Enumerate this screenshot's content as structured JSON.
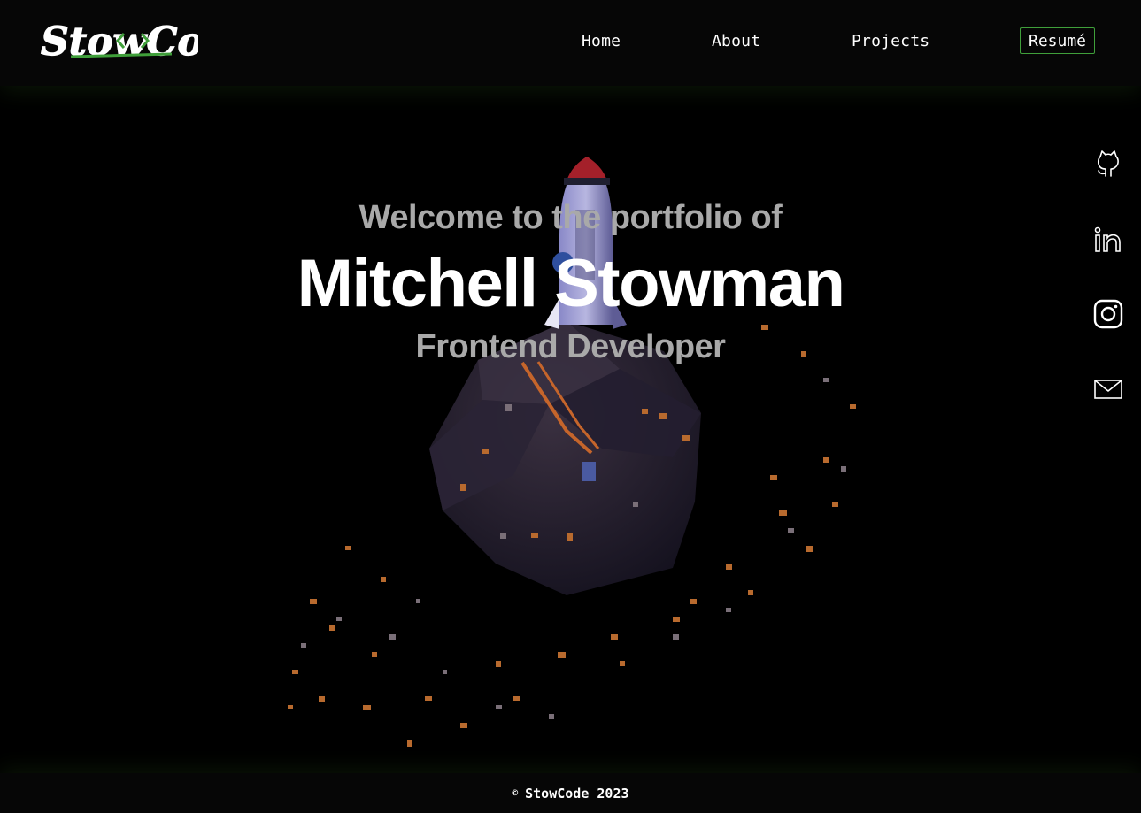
{
  "header": {
    "logo_text": "StowCode",
    "nav": [
      {
        "label": "Home"
      },
      {
        "label": "About"
      },
      {
        "label": "Projects"
      }
    ],
    "resume_label": "Resumé"
  },
  "hero": {
    "welcome": "Welcome to the portfolio of",
    "name": "Mitchell Stowman",
    "role": "Frontend Developer"
  },
  "social": [
    {
      "icon": "github-icon"
    },
    {
      "icon": "linkedin-icon"
    },
    {
      "icon": "instagram-icon"
    },
    {
      "icon": "mail-icon"
    }
  ],
  "footer": {
    "copyright_symbol": "©",
    "text": "StowCode 2023"
  },
  "colors": {
    "accent": "#3f9f3a",
    "background": "#000000",
    "muted_text": "#a9a9a9"
  }
}
